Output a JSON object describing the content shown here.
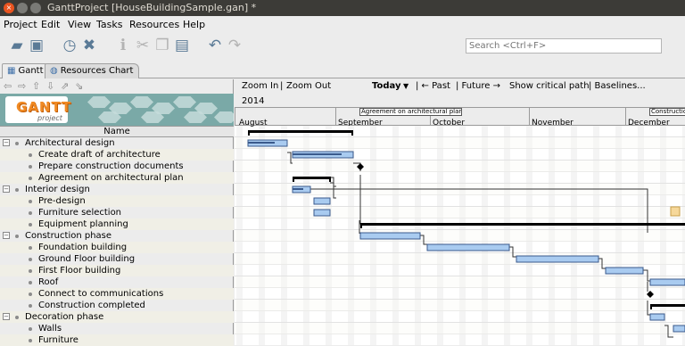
{
  "window": {
    "title": "GanttProject [HouseBuildingSample.gan] *",
    "close_glyph": "×"
  },
  "menu": [
    "Project",
    "Edit",
    "View",
    "Tasks",
    "Resources",
    "Help"
  ],
  "toolbar": {
    "icons": [
      {
        "name": "open-folder-icon",
        "glyph": "▰",
        "enabled": true
      },
      {
        "name": "save-icon",
        "glyph": "▣",
        "enabled": true
      },
      {
        "name": "history-icon",
        "glyph": "◷",
        "enabled": true
      },
      {
        "name": "delete-icon",
        "glyph": "✖",
        "enabled": true
      },
      {
        "name": "properties-icon",
        "glyph": "ℹ",
        "enabled": false
      },
      {
        "name": "cut-icon",
        "glyph": "✂",
        "enabled": false
      },
      {
        "name": "copy-icon",
        "glyph": "❐",
        "enabled": false
      },
      {
        "name": "paste-icon",
        "glyph": "▤",
        "enabled": true
      },
      {
        "name": "undo-icon",
        "glyph": "↶",
        "enabled": true
      },
      {
        "name": "redo-icon",
        "glyph": "↷",
        "enabled": false
      }
    ],
    "search_placeholder": "Search <Ctrl+F>"
  },
  "tabs": [
    {
      "label": "Gantt",
      "icon": "gantt-icon",
      "glyph": "▦",
      "active": true
    },
    {
      "label": "Resources Chart",
      "icon": "resources-icon",
      "glyph": "◍",
      "active": false
    }
  ],
  "tree_nav_glyphs": [
    "⇦",
    "⇨",
    "⇧",
    "⇩",
    "⇗",
    "⇘"
  ],
  "logo": {
    "title": "GANTT",
    "subtitle": "project"
  },
  "table": {
    "header": "Name",
    "rows": [
      {
        "name": "Architectural design",
        "level": 0
      },
      {
        "name": "Create draft of architecture",
        "level": 1
      },
      {
        "name": "Prepare construction documents",
        "level": 1
      },
      {
        "name": "Agreement on architectural plan",
        "level": 1
      },
      {
        "name": "Interior design",
        "level": 0
      },
      {
        "name": "Pre-design",
        "level": 1
      },
      {
        "name": "Furniture selection",
        "level": 1
      },
      {
        "name": "Equipment planning",
        "level": 1
      },
      {
        "name": "Construction phase",
        "level": 0
      },
      {
        "name": "Foundation building",
        "level": 1
      },
      {
        "name": "Ground Floor building",
        "level": 1
      },
      {
        "name": "First Floor building",
        "level": 1
      },
      {
        "name": "Roof",
        "level": 1
      },
      {
        "name": "Connect to communications",
        "level": 1
      },
      {
        "name": "Construction completed",
        "level": 1
      },
      {
        "name": "Decoration phase",
        "level": 0
      },
      {
        "name": "Walls",
        "level": 1
      },
      {
        "name": "Furniture",
        "level": 1
      }
    ]
  },
  "chart_controls": {
    "zoom_in": "Zoom In",
    "zoom_out": "Zoom Out",
    "sep": "|",
    "today": "Today",
    "past": "| ← Past",
    "future": "| Future →",
    "critical": "Show critical path",
    "baselines": "| Baselines..."
  },
  "timeline": {
    "year": "2014",
    "months": [
      "August",
      "September",
      "October",
      "November",
      "December"
    ],
    "milestone_labels": [
      "Agreement on architectural plan",
      "Construction completed"
    ]
  },
  "colors": {
    "task_fill": "#a9cbf0",
    "task_border": "#3a5a8c",
    "summary": "#000000",
    "row_alt": "#f0efe6",
    "weekend": "#f4f4f4",
    "accent_orange": "#f08a24"
  }
}
